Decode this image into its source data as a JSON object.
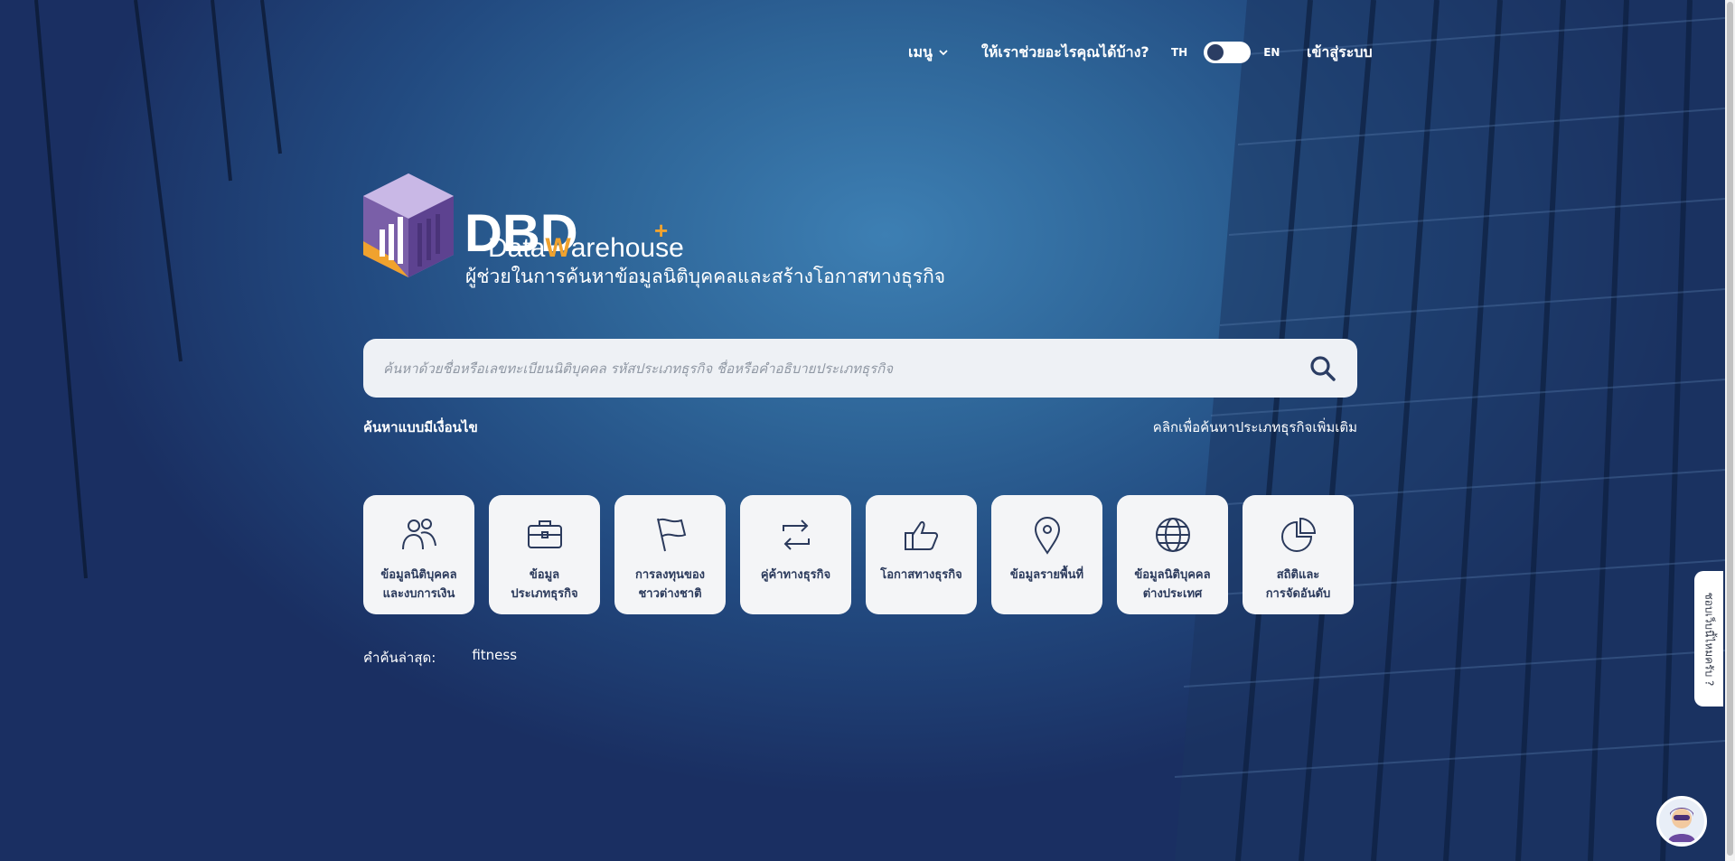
{
  "header": {
    "menu_label": "เมนู",
    "help_label": "ให้เราช่วยอะไรคุณได้บ้าง?",
    "lang_th": "TH",
    "lang_en": "EN",
    "login_label": "เข้าสู่ระบบ"
  },
  "logo": {
    "dbd": "DBD",
    "data": "Data",
    "warehouse_w": "W",
    "warehouse_rest": "arehouse",
    "plus": "+"
  },
  "tagline": "ผู้ช่วยในการค้นหาข้อมูลนิติบุคคลและสร้างโอกาสทางธุรกิจ",
  "search": {
    "placeholder": "ค้นหาด้วยชื่อหรือเลขทะเบียนนิติบุคคล รหัสประเภทธุรกิจ ชื่อหรือคำอธิบายประเภทธุรกิจ",
    "value": ""
  },
  "links": {
    "advanced_search": "ค้นหาแบบมีเงื่อนไข",
    "more_types": "คลิกเพื่อค้นหาประเภทธุรกิจเพิ่มเติม"
  },
  "categories": [
    {
      "label": "ข้อมูลนิติบุคคล\nและงบการเงิน",
      "icon": "people-icon"
    },
    {
      "label": "ข้อมูล\nประเภทธุรกิจ",
      "icon": "briefcase-icon"
    },
    {
      "label": "การลงทุนของ\nชาวต่างชาติ",
      "icon": "flag-icon"
    },
    {
      "label": "คู่ค้าทางธุรกิจ",
      "icon": "exchange-icon"
    },
    {
      "label": "โอกาสทางธุรกิจ",
      "icon": "thumbs-up-icon"
    },
    {
      "label": "ข้อมูลรายพื้นที่",
      "icon": "map-pin-icon"
    },
    {
      "label": "ข้อมูลนิติบุคคล\nต่างประเทศ",
      "icon": "globe-icon"
    },
    {
      "label": "สถิติและ\nการจัดอันดับ",
      "icon": "pie-chart-icon"
    }
  ],
  "recent": {
    "label": "คำค้นล่าสุด:",
    "term": "fitness"
  },
  "feedback_label": "ชอบเว็บนี้ไหมครับ ?",
  "colors": {
    "accent_orange": "#f0a22e",
    "logo_purple": "#7a5fa8",
    "card_text": "#2b3a5c"
  }
}
